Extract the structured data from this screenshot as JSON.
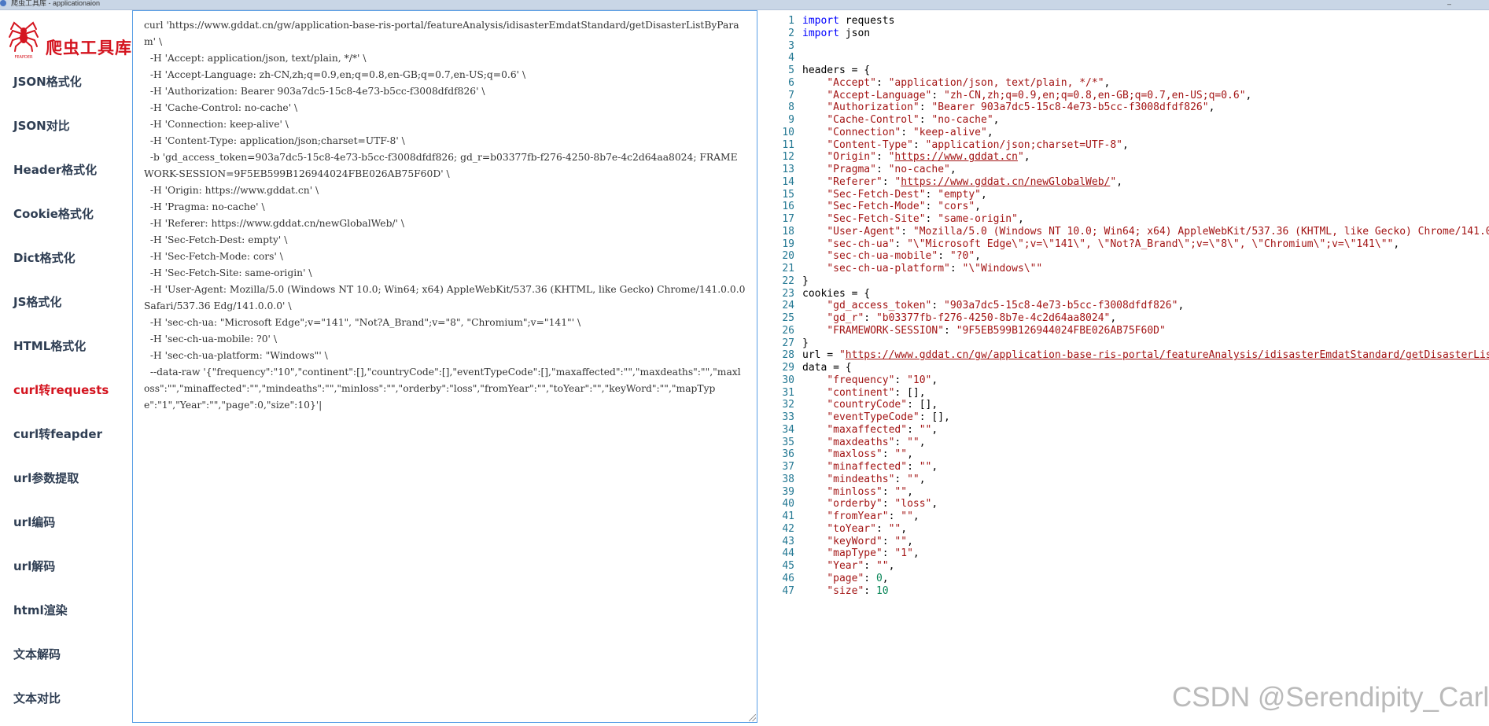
{
  "window": {
    "title": "爬虫工具库 - applicationaion"
  },
  "brand": {
    "name": "爬虫工具库",
    "logo_caption": "FEAPDER"
  },
  "sidebar": {
    "items": [
      {
        "label": "JSON格式化",
        "active": false
      },
      {
        "label": "JSON对比",
        "active": false
      },
      {
        "label": "Header格式化",
        "active": false
      },
      {
        "label": "Cookie格式化",
        "active": false
      },
      {
        "label": "Dict格式化",
        "active": false
      },
      {
        "label": "JS格式化",
        "active": false
      },
      {
        "label": "HTML格式化",
        "active": false
      },
      {
        "label": "curl转requests",
        "active": true
      },
      {
        "label": "curl转feapder",
        "active": false
      },
      {
        "label": "url参数提取",
        "active": false
      },
      {
        "label": "url编码",
        "active": false
      },
      {
        "label": "url解码",
        "active": false
      },
      {
        "label": "html渲染",
        "active": false
      },
      {
        "label": "文本解码",
        "active": false
      },
      {
        "label": "文本对比",
        "active": false
      }
    ]
  },
  "input": {
    "curl_text": "curl 'https://www.gddat.cn/gw/application-base-ris-portal/featureAnalysis/idisasterEmdatStandard/getDisasterListByParam' \\\n  -H 'Accept: application/json, text/plain, */*' \\\n  -H 'Accept-Language: zh-CN,zh;q=0.9,en;q=0.8,en-GB;q=0.7,en-US;q=0.6' \\\n  -H 'Authorization: Bearer 903a7dc5-15c8-4e73-b5cc-f3008dfdf826' \\\n  -H 'Cache-Control: no-cache' \\\n  -H 'Connection: keep-alive' \\\n  -H 'Content-Type: application/json;charset=UTF-8' \\\n  -b 'gd_access_token=903a7dc5-15c8-4e73-b5cc-f3008dfdf826; gd_r=b03377fb-f276-4250-8b7e-4c2d64aa8024; FRAMEWORK-SESSION=9F5EB599B126944024FBE026AB75F60D' \\\n  -H 'Origin: https://www.gddat.cn' \\\n  -H 'Pragma: no-cache' \\\n  -H 'Referer: https://www.gddat.cn/newGlobalWeb/' \\\n  -H 'Sec-Fetch-Dest: empty' \\\n  -H 'Sec-Fetch-Mode: cors' \\\n  -H 'Sec-Fetch-Site: same-origin' \\\n  -H 'User-Agent: Mozilla/5.0 (Windows NT 10.0; Win64; x64) AppleWebKit/537.36 (KHTML, like Gecko) Chrome/141.0.0.0 Safari/537.36 Edg/141.0.0.0' \\\n  -H 'sec-ch-ua: \"Microsoft Edge\";v=\"141\", \"Not?A_Brand\";v=\"8\", \"Chromium\";v=\"141\"' \\\n  -H 'sec-ch-ua-mobile: ?0' \\\n  -H 'sec-ch-ua-platform: \"Windows\"' \\\n  --data-raw '{\"frequency\":\"10\",\"continent\":[],\"countryCode\":[],\"eventTypeCode\":[],\"maxaffected\":\"\",\"maxdeaths\":\"\",\"maxloss\":\"\",\"minaffected\":\"\",\"mindeaths\":\"\",\"minloss\":\"\",\"orderby\":\"loss\",\"fromYear\":\"\",\"toYear\":\"\",\"keyWord\":\"\",\"mapType\":\"1\",\"Year\":\"\",\"page\":0,\"size\":10}'|"
  },
  "output": {
    "lines": [
      {
        "n": "1",
        "segs": [
          [
            "kw",
            "import"
          ],
          [
            "t",
            " requests"
          ]
        ]
      },
      {
        "n": "2",
        "segs": [
          [
            "kw",
            "import"
          ],
          [
            "t",
            " json"
          ]
        ]
      },
      {
        "n": "3",
        "segs": []
      },
      {
        "n": "4",
        "segs": []
      },
      {
        "n": "5",
        "segs": [
          [
            "t",
            "headers = {"
          ]
        ]
      },
      {
        "n": "6",
        "segs": [
          [
            "t",
            "    "
          ],
          [
            "s",
            "\"Accept\""
          ],
          [
            "t",
            ": "
          ],
          [
            "s",
            "\"application/json, text/plain, */*\""
          ],
          [
            "t",
            ","
          ]
        ]
      },
      {
        "n": "7",
        "segs": [
          [
            "t",
            "    "
          ],
          [
            "s",
            "\"Accept-Language\""
          ],
          [
            "t",
            ": "
          ],
          [
            "s",
            "\"zh-CN,zh;q=0.9,en;q=0.8,en-GB;q=0.7,en-US;q=0.6\""
          ],
          [
            "t",
            ","
          ]
        ]
      },
      {
        "n": "8",
        "segs": [
          [
            "t",
            "    "
          ],
          [
            "s",
            "\"Authorization\""
          ],
          [
            "t",
            ": "
          ],
          [
            "s",
            "\"Bearer 903a7dc5-15c8-4e73-b5cc-f3008dfdf826\""
          ],
          [
            "t",
            ","
          ]
        ]
      },
      {
        "n": "9",
        "segs": [
          [
            "t",
            "    "
          ],
          [
            "s",
            "\"Cache-Control\""
          ],
          [
            "t",
            ": "
          ],
          [
            "s",
            "\"no-cache\""
          ],
          [
            "t",
            ","
          ]
        ]
      },
      {
        "n": "10",
        "segs": [
          [
            "t",
            "    "
          ],
          [
            "s",
            "\"Connection\""
          ],
          [
            "t",
            ": "
          ],
          [
            "s",
            "\"keep-alive\""
          ],
          [
            "t",
            ","
          ]
        ]
      },
      {
        "n": "11",
        "segs": [
          [
            "t",
            "    "
          ],
          [
            "s",
            "\"Content-Type\""
          ],
          [
            "t",
            ": "
          ],
          [
            "s",
            "\"application/json;charset=UTF-8\""
          ],
          [
            "t",
            ","
          ]
        ]
      },
      {
        "n": "12",
        "segs": [
          [
            "t",
            "    "
          ],
          [
            "s",
            "\"Origin\""
          ],
          [
            "t",
            ": "
          ],
          [
            "s",
            "\""
          ],
          [
            "l",
            "https://www.gddat.cn"
          ],
          [
            "s",
            "\""
          ],
          [
            "t",
            ","
          ]
        ]
      },
      {
        "n": "13",
        "segs": [
          [
            "t",
            "    "
          ],
          [
            "s",
            "\"Pragma\""
          ],
          [
            "t",
            ": "
          ],
          [
            "s",
            "\"no-cache\""
          ],
          [
            "t",
            ","
          ]
        ]
      },
      {
        "n": "14",
        "segs": [
          [
            "t",
            "    "
          ],
          [
            "s",
            "\"Referer\""
          ],
          [
            "t",
            ": "
          ],
          [
            "s",
            "\""
          ],
          [
            "l",
            "https://www.gddat.cn/newGlobalWeb/"
          ],
          [
            "s",
            "\""
          ],
          [
            "t",
            ","
          ]
        ]
      },
      {
        "n": "15",
        "segs": [
          [
            "t",
            "    "
          ],
          [
            "s",
            "\"Sec-Fetch-Dest\""
          ],
          [
            "t",
            ": "
          ],
          [
            "s",
            "\"empty\""
          ],
          [
            "t",
            ","
          ]
        ]
      },
      {
        "n": "16",
        "segs": [
          [
            "t",
            "    "
          ],
          [
            "s",
            "\"Sec-Fetch-Mode\""
          ],
          [
            "t",
            ": "
          ],
          [
            "s",
            "\"cors\""
          ],
          [
            "t",
            ","
          ]
        ]
      },
      {
        "n": "17",
        "segs": [
          [
            "t",
            "    "
          ],
          [
            "s",
            "\"Sec-Fetch-Site\""
          ],
          [
            "t",
            ": "
          ],
          [
            "s",
            "\"same-origin\""
          ],
          [
            "t",
            ","
          ]
        ]
      },
      {
        "n": "18",
        "segs": [
          [
            "t",
            "    "
          ],
          [
            "s",
            "\"User-Agent\""
          ],
          [
            "t",
            ": "
          ],
          [
            "s",
            "\"Mozilla/5.0 (Windows NT 10.0; Win64; x64) AppleWebKit/537.36 (KHTML, like Gecko) Chrome/141.0"
          ]
        ]
      },
      {
        "n": "19",
        "segs": [
          [
            "t",
            "    "
          ],
          [
            "s",
            "\"sec-ch-ua\""
          ],
          [
            "t",
            ": "
          ],
          [
            "s",
            "\"\\\"Microsoft Edge\\\";v=\\\"141\\\", \\\"Not?A_Brand\\\";v=\\\"8\\\", \\\"Chromium\\\";v=\\\"141\\\"\""
          ],
          [
            "t",
            ","
          ]
        ]
      },
      {
        "n": "20",
        "segs": [
          [
            "t",
            "    "
          ],
          [
            "s",
            "\"sec-ch-ua-mobile\""
          ],
          [
            "t",
            ": "
          ],
          [
            "s",
            "\"?0\""
          ],
          [
            "t",
            ","
          ]
        ]
      },
      {
        "n": "21",
        "segs": [
          [
            "t",
            "    "
          ],
          [
            "s",
            "\"sec-ch-ua-platform\""
          ],
          [
            "t",
            ": "
          ],
          [
            "s",
            "\"\\\"Windows\\\"\""
          ]
        ]
      },
      {
        "n": "22",
        "segs": [
          [
            "t",
            "}"
          ]
        ]
      },
      {
        "n": "23",
        "segs": [
          [
            "t",
            "cookies = {"
          ]
        ]
      },
      {
        "n": "24",
        "segs": [
          [
            "t",
            "    "
          ],
          [
            "s",
            "\"gd_access_token\""
          ],
          [
            "t",
            ": "
          ],
          [
            "s",
            "\"903a7dc5-15c8-4e73-b5cc-f3008dfdf826\""
          ],
          [
            "t",
            ","
          ]
        ]
      },
      {
        "n": "25",
        "segs": [
          [
            "t",
            "    "
          ],
          [
            "s",
            "\"gd_r\""
          ],
          [
            "t",
            ": "
          ],
          [
            "s",
            "\"b03377fb-f276-4250-8b7e-4c2d64aa8024\""
          ],
          [
            "t",
            ","
          ]
        ]
      },
      {
        "n": "26",
        "segs": [
          [
            "t",
            "    "
          ],
          [
            "s",
            "\"FRAMEWORK-SESSION\""
          ],
          [
            "t",
            ": "
          ],
          [
            "s",
            "\"9F5EB599B126944024FBE026AB75F60D\""
          ]
        ]
      },
      {
        "n": "27",
        "segs": [
          [
            "t",
            "}"
          ]
        ]
      },
      {
        "n": "28",
        "segs": [
          [
            "t",
            "url = "
          ],
          [
            "s",
            "\""
          ],
          [
            "l",
            "https://www.gddat.cn/gw/application-base-ris-portal/featureAnalysis/idisasterEmdatStandard/getDisasterLis"
          ]
        ]
      },
      {
        "n": "29",
        "segs": [
          [
            "t",
            "data = {"
          ]
        ]
      },
      {
        "n": "30",
        "segs": [
          [
            "t",
            "    "
          ],
          [
            "s",
            "\"frequency\""
          ],
          [
            "t",
            ": "
          ],
          [
            "s",
            "\"10\""
          ],
          [
            "t",
            ","
          ]
        ]
      },
      {
        "n": "31",
        "segs": [
          [
            "t",
            "    "
          ],
          [
            "s",
            "\"continent\""
          ],
          [
            "t",
            ": [],"
          ]
        ]
      },
      {
        "n": "32",
        "segs": [
          [
            "t",
            "    "
          ],
          [
            "s",
            "\"countryCode\""
          ],
          [
            "t",
            ": [],"
          ]
        ]
      },
      {
        "n": "33",
        "segs": [
          [
            "t",
            "    "
          ],
          [
            "s",
            "\"eventTypeCode\""
          ],
          [
            "t",
            ": [],"
          ]
        ]
      },
      {
        "n": "34",
        "segs": [
          [
            "t",
            "    "
          ],
          [
            "s",
            "\"maxaffected\""
          ],
          [
            "t",
            ": "
          ],
          [
            "s",
            "\"\""
          ],
          [
            "t",
            ","
          ]
        ]
      },
      {
        "n": "35",
        "segs": [
          [
            "t",
            "    "
          ],
          [
            "s",
            "\"maxdeaths\""
          ],
          [
            "t",
            ": "
          ],
          [
            "s",
            "\"\""
          ],
          [
            "t",
            ","
          ]
        ]
      },
      {
        "n": "36",
        "segs": [
          [
            "t",
            "    "
          ],
          [
            "s",
            "\"maxloss\""
          ],
          [
            "t",
            ": "
          ],
          [
            "s",
            "\"\""
          ],
          [
            "t",
            ","
          ]
        ]
      },
      {
        "n": "37",
        "segs": [
          [
            "t",
            "    "
          ],
          [
            "s",
            "\"minaffected\""
          ],
          [
            "t",
            ": "
          ],
          [
            "s",
            "\"\""
          ],
          [
            "t",
            ","
          ]
        ]
      },
      {
        "n": "38",
        "segs": [
          [
            "t",
            "    "
          ],
          [
            "s",
            "\"mindeaths\""
          ],
          [
            "t",
            ": "
          ],
          [
            "s",
            "\"\""
          ],
          [
            "t",
            ","
          ]
        ]
      },
      {
        "n": "39",
        "segs": [
          [
            "t",
            "    "
          ],
          [
            "s",
            "\"minloss\""
          ],
          [
            "t",
            ": "
          ],
          [
            "s",
            "\"\""
          ],
          [
            "t",
            ","
          ]
        ]
      },
      {
        "n": "40",
        "segs": [
          [
            "t",
            "    "
          ],
          [
            "s",
            "\"orderby\""
          ],
          [
            "t",
            ": "
          ],
          [
            "s",
            "\"loss\""
          ],
          [
            "t",
            ","
          ]
        ]
      },
      {
        "n": "41",
        "segs": [
          [
            "t",
            "    "
          ],
          [
            "s",
            "\"fromYear\""
          ],
          [
            "t",
            ": "
          ],
          [
            "s",
            "\"\""
          ],
          [
            "t",
            ","
          ]
        ]
      },
      {
        "n": "42",
        "segs": [
          [
            "t",
            "    "
          ],
          [
            "s",
            "\"toYear\""
          ],
          [
            "t",
            ": "
          ],
          [
            "s",
            "\"\""
          ],
          [
            "t",
            ","
          ]
        ]
      },
      {
        "n": "43",
        "segs": [
          [
            "t",
            "    "
          ],
          [
            "s",
            "\"keyWord\""
          ],
          [
            "t",
            ": "
          ],
          [
            "s",
            "\"\""
          ],
          [
            "t",
            ","
          ]
        ]
      },
      {
        "n": "44",
        "segs": [
          [
            "t",
            "    "
          ],
          [
            "s",
            "\"mapType\""
          ],
          [
            "t",
            ": "
          ],
          [
            "s",
            "\"1\""
          ],
          [
            "t",
            ","
          ]
        ]
      },
      {
        "n": "45",
        "segs": [
          [
            "t",
            "    "
          ],
          [
            "s",
            "\"Year\""
          ],
          [
            "t",
            ": "
          ],
          [
            "s",
            "\"\""
          ],
          [
            "t",
            ","
          ]
        ]
      },
      {
        "n": "46",
        "segs": [
          [
            "t",
            "    "
          ],
          [
            "s",
            "\"page\""
          ],
          [
            "t",
            ": "
          ],
          [
            "n",
            "0"
          ],
          [
            "t",
            ","
          ]
        ]
      },
      {
        "n": "47",
        "segs": [
          [
            "t",
            "    "
          ],
          [
            "s",
            "\"size\""
          ],
          [
            "t",
            ": "
          ],
          [
            "n",
            "10"
          ]
        ]
      }
    ]
  },
  "watermark": "CSDN @Serendipity_Carl",
  "colors": {
    "brand_red": "#d4141f",
    "keyword_blue": "#0000ff",
    "string_red": "#a31515",
    "number_green": "#098658",
    "line_number": "#237893",
    "focus_border": "#5a9fe6"
  }
}
